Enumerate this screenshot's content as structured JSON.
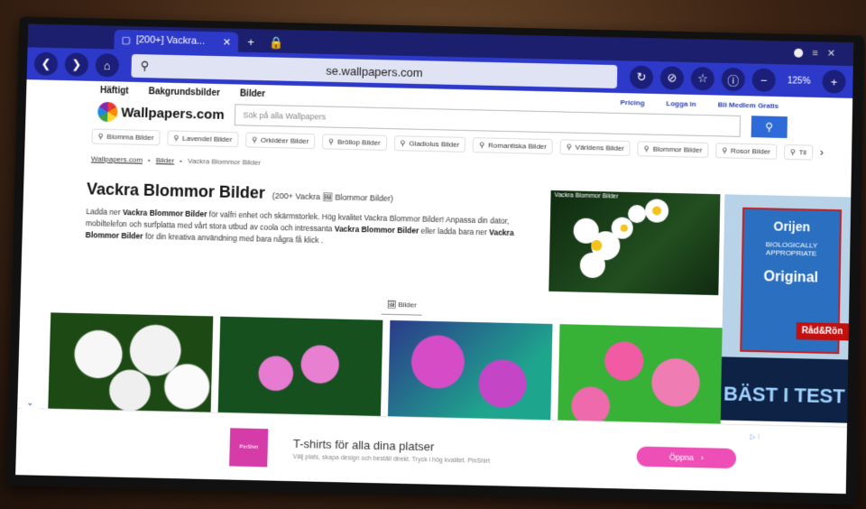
{
  "browser": {
    "tab_title": "[200+] Vackra...",
    "tab_close": "✕",
    "new_tab": "+",
    "lock": "🔒",
    "url": "se.wallpapers.com",
    "zoom": "125%",
    "icons": {
      "back": "❮",
      "forward": "❯",
      "home": "⌂",
      "search": "⚲",
      "reload": "↻",
      "tracker": "⊘",
      "bookmark": "☆",
      "info": "ⓘ",
      "zoom_out": "−",
      "zoom_in": "+",
      "menu": "≡",
      "window_close": "✕"
    }
  },
  "site": {
    "nav": [
      "Häftigt",
      "Bakgrundsbilder",
      "Bilder"
    ],
    "nav_right": [
      "Pricing",
      "Logga in",
      "Bli Medlem Gratis"
    ],
    "logo_text": "Wallpapers.com",
    "search_placeholder": "Sök på alla Wallpapers",
    "search_icon": "⚲",
    "chips": [
      "Blomma Bilder",
      "Lavendel Bilder",
      "Orkidéer Bilder",
      "Bröllop Bilder",
      "Gladiolus Bilder",
      "Romantiska Bilder",
      "Världens Bilder",
      "Blommor Bilder",
      "Rosor Bilder",
      "Til"
    ],
    "chip_icon": "⚲",
    "chips_next": "›",
    "breadcrumb": [
      "Wallpapers.com",
      "Bilder",
      "Vackra Blommor Bilder"
    ],
    "breadcrumb_sep": "•",
    "title": "Vackra Blommor Bilder",
    "subtitle": "(200+ Vackra 🖼 Blommor Bilder)",
    "desc_1": "Ladda ner ",
    "desc_b1": "Vackra Blommor Bilder",
    "desc_2": " för valfri enhet och skärmstorlek. Hög kvalitet Vackra Blommor Bilder! Anpassa din dator, mobiltelefon och surfplatta med vårt stora utbud av coola och intressanta ",
    "desc_b2": "Vackra Blommor Bilder",
    "desc_3": " eller ladda bara ner ",
    "desc_b3": "Vackra Blommor Bilder",
    "desc_4": " för din kreativa användning med bara några få klick .",
    "feature_caption": "Vackra Blommor Bilder",
    "images_tab": "🖼 Bilder"
  },
  "side_ad": {
    "brand": "Orijen",
    "product": "Original",
    "small": "BIOLOGICALLY APPROPRIATE",
    "badge": "Råd&Rön",
    "headline": "BÄST I TEST"
  },
  "bottom_ad": {
    "collapse": "⌄",
    "logo": "PinShirt",
    "title": "T-shirts för alla dina platser",
    "subtitle": "Välj plats, skapa design och beställ direkt. Tryck i hög kvalitet. PinShirt",
    "cta": "Öppna",
    "cta_icon": "›",
    "info": "▷ ⁝"
  }
}
